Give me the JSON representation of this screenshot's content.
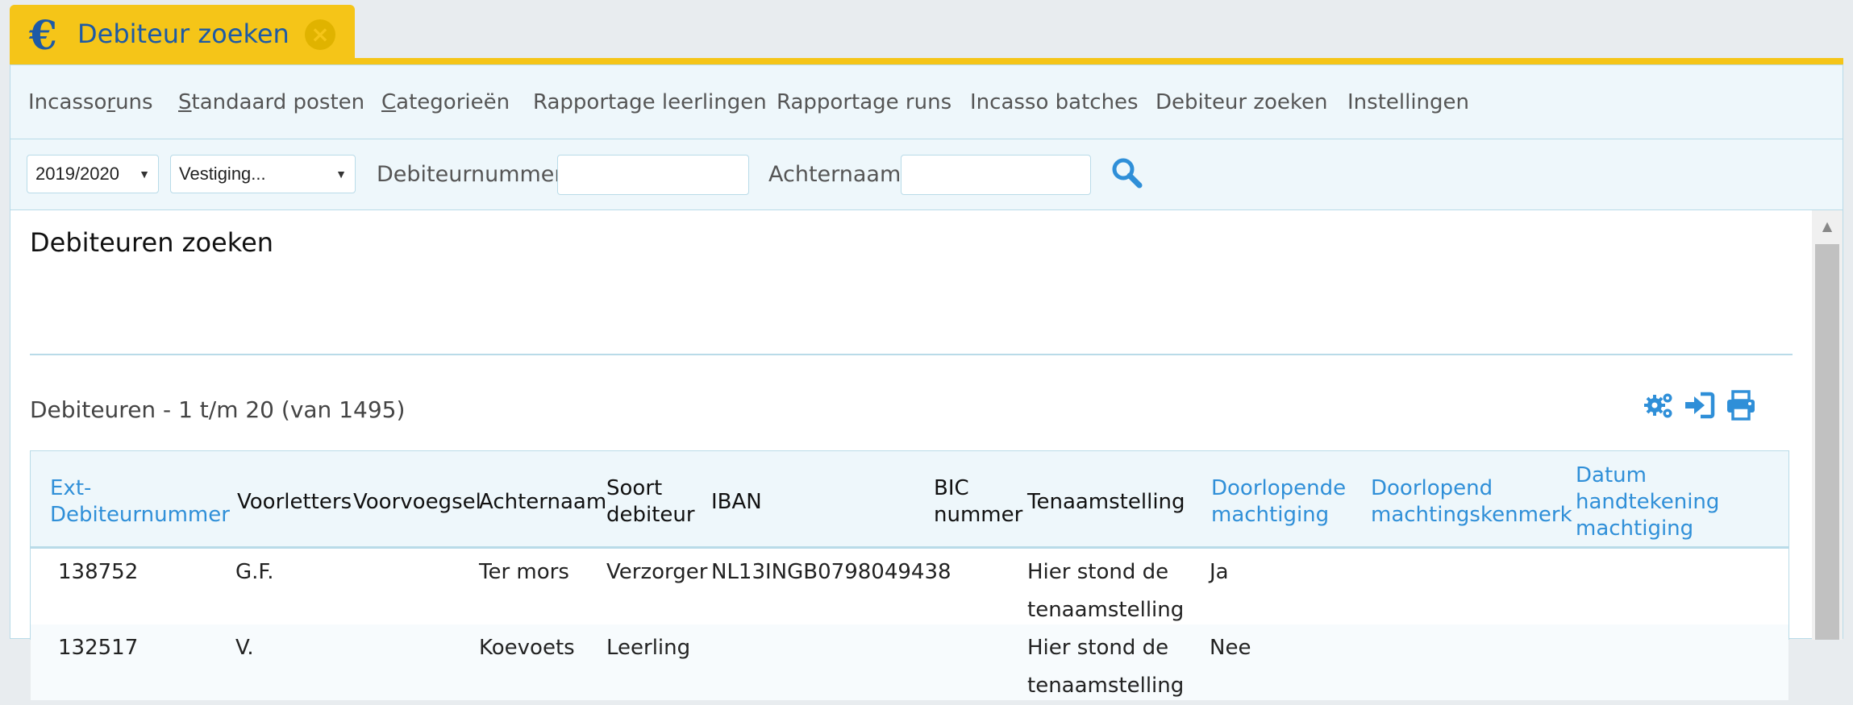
{
  "tab": {
    "icon": "euro-icon",
    "title": "Debiteur zoeken",
    "close_icon": "close-circle-icon"
  },
  "colors": {
    "accent_yellow": "#f5c518",
    "brand_blue": "#1d5aa6",
    "link_blue": "#2f8fd8",
    "border": "#b9dbe8"
  },
  "menu": {
    "items": [
      {
        "pre": "Incasso",
        "u": "r",
        "post": "uns"
      },
      {
        "pre": "",
        "u": "S",
        "post": "tandaard posten"
      },
      {
        "pre": "",
        "u": "C",
        "post": "ategorieën"
      },
      {
        "pre": "Rapportage leerlingen",
        "u": "",
        "post": ""
      },
      {
        "pre": "Rapportage runs",
        "u": "",
        "post": ""
      },
      {
        "pre": "Incasso batches",
        "u": "",
        "post": ""
      },
      {
        "pre": "Debiteur zoeken",
        "u": "",
        "post": ""
      },
      {
        "pre": "Instellingen",
        "u": "",
        "post": ""
      }
    ]
  },
  "filters": {
    "year_value": "2019/2020",
    "location_value": "Vestiging...",
    "debtor_number_label": "Debiteurnummer",
    "debtor_number_value": "",
    "last_name_label": "Achternaam",
    "last_name_value": "",
    "search_icon": "search-icon"
  },
  "page": {
    "title": "Debiteuren zoeken",
    "result_title": "Debiteuren - 1 t/m 20 (van 1495)",
    "actions": [
      "settings-gear-icon",
      "export-sign-in-icon",
      "print-icon"
    ]
  },
  "table": {
    "columns": [
      {
        "label": "Ext-\nDebiteurnummer",
        "link": true
      },
      {
        "label": "Voorletters",
        "link": false
      },
      {
        "label": "Voorvoegsel",
        "link": false
      },
      {
        "label": "Achternaam",
        "link": false
      },
      {
        "label": "Soort\ndebiteur",
        "link": false
      },
      {
        "label": "IBAN",
        "link": false
      },
      {
        "label": "BIC\nnummer",
        "link": false
      },
      {
        "label": "Tenaamstelling",
        "link": false
      },
      {
        "label": "Doorlopende\nmachtiging",
        "link": true
      },
      {
        "label": "Doorlopend\nmachtingskenmerk",
        "link": true
      },
      {
        "label": "Datum\nhandtekening\nmachtiging",
        "link": true
      }
    ],
    "rows": [
      {
        "cells": [
          "138752",
          "G.F.",
          "",
          "Ter mors",
          "Verzorger",
          "NL13INGB0798049438",
          "",
          "Hier stond de\ntenaamstelling",
          "Ja",
          "",
          ""
        ]
      },
      {
        "cells": [
          "132517",
          "V.",
          "",
          "Koevoets",
          "Leerling",
          "",
          "",
          "Hier stond de\ntenaamstelling",
          "Nee",
          "",
          ""
        ]
      }
    ]
  }
}
